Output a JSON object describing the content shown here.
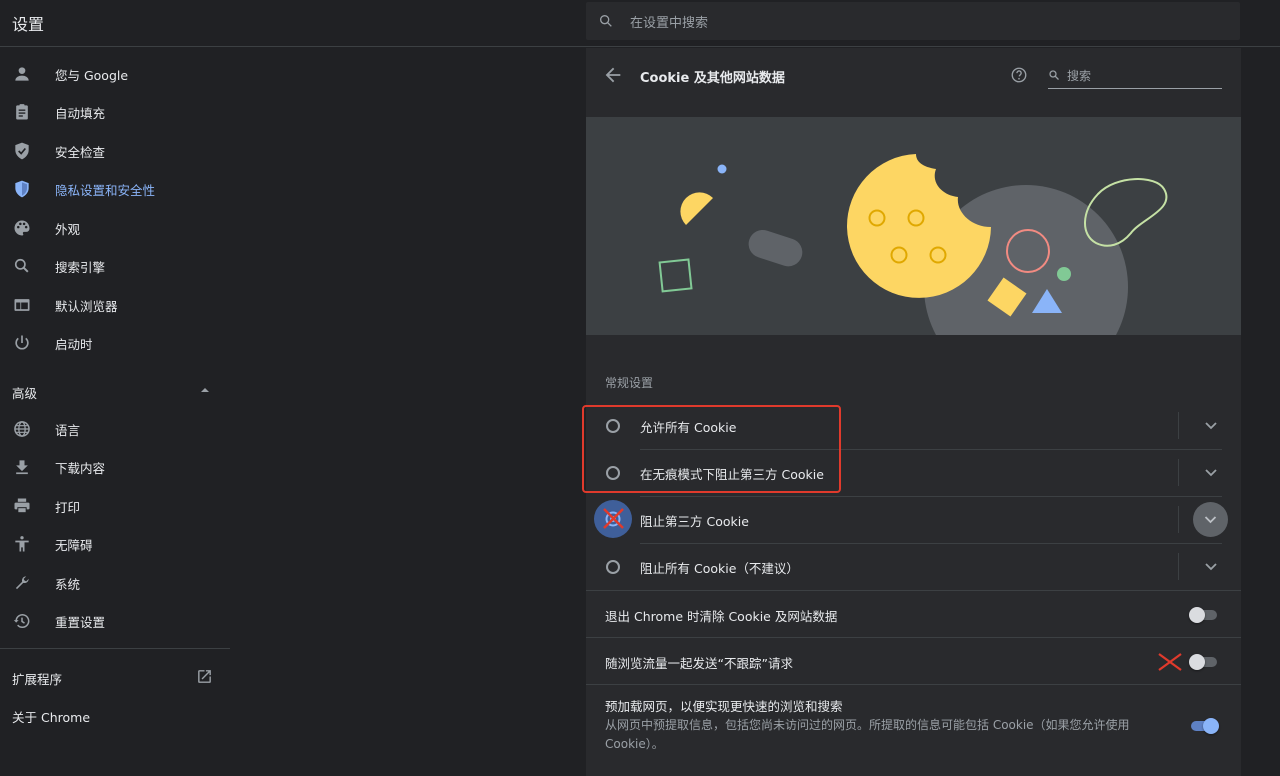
{
  "app": {
    "title": "设置"
  },
  "search": {
    "placeholder": "在设置中搜索"
  },
  "sidebar": {
    "items": [
      {
        "label": "您与 Google",
        "icon": "person-icon"
      },
      {
        "label": "自动填充",
        "icon": "clipboard-icon"
      },
      {
        "label": "安全检查",
        "icon": "shield-check-icon"
      },
      {
        "label": "隐私设置和安全性",
        "icon": "shield-icon"
      },
      {
        "label": "外观",
        "icon": "palette-icon"
      },
      {
        "label": "搜索引擎",
        "icon": "search-icon"
      },
      {
        "label": "默认浏览器",
        "icon": "browser-icon"
      },
      {
        "label": "启动时",
        "icon": "power-icon"
      }
    ],
    "advanced_label": "高级",
    "advanced_items": [
      {
        "label": "语言",
        "icon": "globe-icon"
      },
      {
        "label": "下载内容",
        "icon": "download-icon"
      },
      {
        "label": "打印",
        "icon": "printer-icon"
      },
      {
        "label": "无障碍",
        "icon": "accessibility-icon"
      },
      {
        "label": "系统",
        "icon": "wrench-icon"
      },
      {
        "label": "重置设置",
        "icon": "history-icon"
      }
    ],
    "extensions_label": "扩展程序",
    "about_label": "关于 Chrome",
    "active_index": 3
  },
  "card": {
    "title": "Cookie 及其他网站数据",
    "search_placeholder": "搜索",
    "section_label": "常规设置",
    "radio_options": [
      {
        "label": "允许所有 Cookie"
      },
      {
        "label": "在无痕模式下阻止第三方 Cookie"
      },
      {
        "label": "阻止第三方 Cookie"
      },
      {
        "label": "阻止所有 Cookie（不建议）"
      }
    ],
    "toggles": [
      {
        "label": "退出 Chrome 时清除 Cookie 及网站数据",
        "on": false
      },
      {
        "label": "随浏览流量一起发送“不跟踪”请求",
        "on": false
      },
      {
        "label": "预加载网页，以便实现更快速的浏览和搜索",
        "sublabel": "从网页中预提取信息，包括您尚未访问过的网页。所提取的信息可能包括 Cookie（如果您允许使用 Cookie）。",
        "on": true
      }
    ]
  },
  "colors": {
    "accent": "#8ab4f8",
    "annotation_red": "#e03a2c",
    "cookie_yellow": "#fdd663",
    "background": "#202124",
    "card": "#292a2d"
  }
}
